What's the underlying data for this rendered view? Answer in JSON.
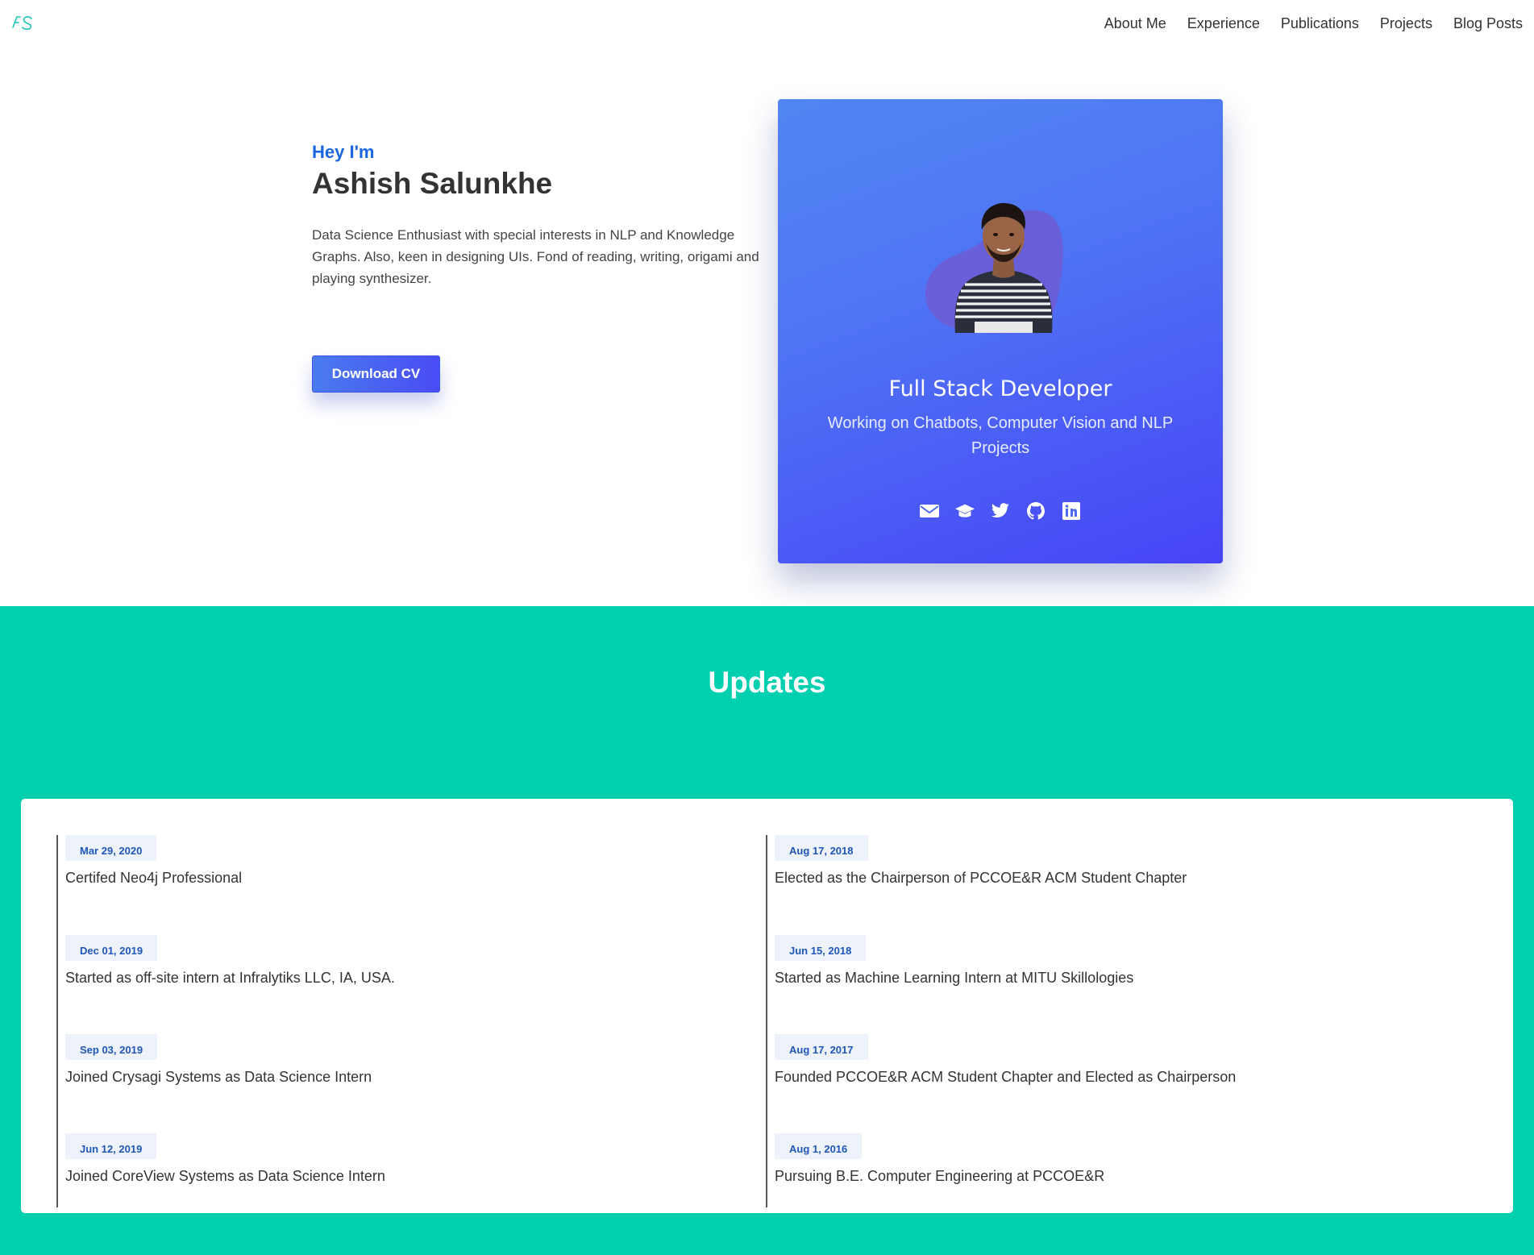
{
  "nav": {
    "logo_text": "AS",
    "links": [
      "About Me",
      "Experience",
      "Publications",
      "Projects",
      "Blog Posts"
    ]
  },
  "hero": {
    "greeting": "Hey I'm",
    "name": "Ashish Salunkhe",
    "bio": "Data Science Enthusiast with special interests in NLP and Knowledge Graphs. Also, keen in designing UIs. Fond of reading, writing, origami and playing synthesizer.",
    "cv_button": "Download CV"
  },
  "card": {
    "title": "Full Stack Developer",
    "subtitle": "Working on Chatbots, Computer Vision and NLP Projects",
    "socials": [
      "envelope-icon",
      "graduation-cap-icon",
      "twitter-icon",
      "github-icon",
      "linkedin-icon"
    ]
  },
  "updates": {
    "title": "Updates",
    "left": [
      {
        "date": "Mar 29, 2020",
        "text": "Certifed Neo4j Professional"
      },
      {
        "date": "Dec 01, 2019",
        "text": "Started as off-site intern at Infralytiks LLC, IA, USA."
      },
      {
        "date": "Sep 03, 2019",
        "text": "Joined Crysagi Systems as Data Science Intern"
      },
      {
        "date": "Jun 12, 2019",
        "text": "Joined CoreView Systems as Data Science Intern"
      }
    ],
    "right": [
      {
        "date": "Aug 17, 2018",
        "text": "Elected as the Chairperson of PCCOE&R ACM Student Chapter"
      },
      {
        "date": "Jun 15, 2018",
        "text": "Started as Machine Learning Intern at MITU Skillologies"
      },
      {
        "date": "Aug 17, 2017",
        "text": "Founded PCCOE&R ACM Student Chapter and Elected as Chairperson"
      },
      {
        "date": "Aug 1, 2016",
        "text": "Pursuing B.E. Computer Engineering at PCCOE&R"
      }
    ]
  },
  "colors": {
    "accent_blue": "#1a66e0",
    "card_gradient_start": "#5186f2",
    "card_gradient_end": "#4744f7",
    "teal": "#00d0b0"
  }
}
